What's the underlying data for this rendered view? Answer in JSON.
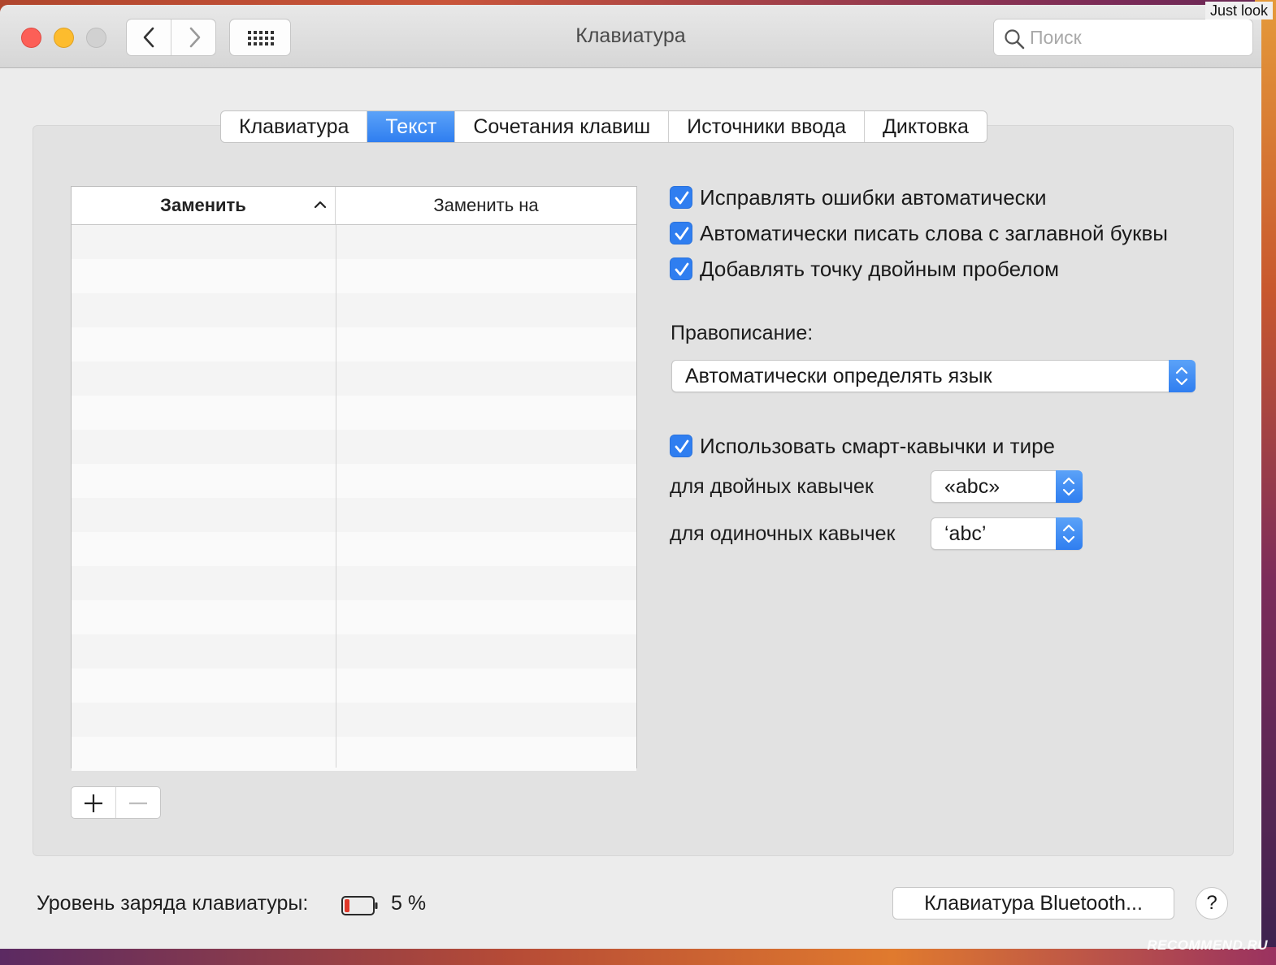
{
  "overlay": {
    "just_look": "Just look",
    "watermark": "RECOMMEND.RU"
  },
  "window": {
    "title": "Клавиатура",
    "search_placeholder": "Поиск"
  },
  "tabs": [
    {
      "label": "Клавиатура",
      "active": false
    },
    {
      "label": "Текст",
      "active": true
    },
    {
      "label": "Сочетания клавиш",
      "active": false
    },
    {
      "label": "Источники ввода",
      "active": false
    },
    {
      "label": "Диктовка",
      "active": false
    }
  ],
  "table": {
    "col_replace": "Заменить",
    "col_with": "Заменить на",
    "rows": []
  },
  "options": {
    "autocorrect": {
      "label": "Исправлять ошибки автоматически",
      "checked": true
    },
    "capitalize": {
      "label": "Автоматически писать слова с заглавной буквы",
      "checked": true
    },
    "period": {
      "label": "Добавлять точку двойным пробелом",
      "checked": true
    },
    "spelling_label": "Правописание:",
    "spelling_value": "Автоматически определять язык",
    "smart_quotes": {
      "label": "Использовать смарт-кавычки и тире",
      "checked": true
    },
    "double_quotes_label": "для двойных кавычек",
    "double_quotes_value": "«abc»",
    "single_quotes_label": "для одиночных кавычек",
    "single_quotes_value": "‘abc’"
  },
  "footer": {
    "battery_label": "Уровень заряда клавиатуры:",
    "battery_value": "5 %",
    "battery_level": 0.05,
    "bluetooth_button": "Клавиатура Bluetooth...",
    "help": "?"
  },
  "colors": {
    "accent": "#2f7ef0",
    "close": "#fc5f57",
    "minimize": "#fdbc2e",
    "battery_low": "#e0392b"
  }
}
